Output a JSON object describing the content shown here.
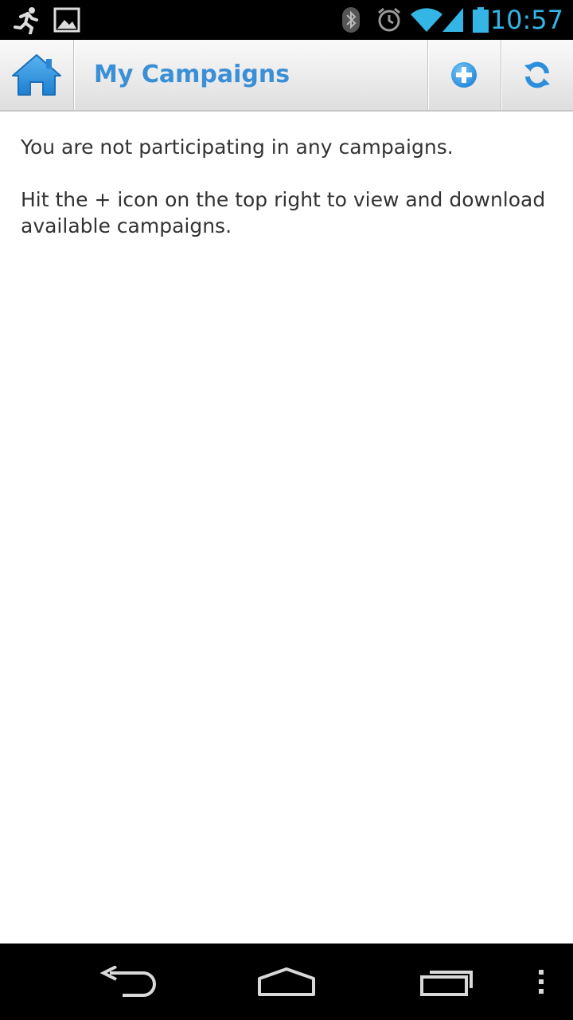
{
  "status_bar": {
    "time": "10:57",
    "icons": [
      "running-man-icon",
      "image-icon",
      "bluetooth-icon",
      "alarm-icon",
      "wifi-icon",
      "signal-icon",
      "battery-icon"
    ],
    "time_color": "#33b5e5"
  },
  "action_bar": {
    "home_icon": "home-icon",
    "title": "My Campaigns",
    "actions": [
      "add-icon",
      "refresh-icon"
    ],
    "accent_color": "#3a8fd6"
  },
  "content": {
    "message_1": "You are not participating in any campaigns.",
    "message_2": "Hit the + icon on the top right to view and download available campaigns."
  },
  "nav_bar": {
    "buttons": [
      "back-icon",
      "home-icon",
      "recent-apps-icon",
      "menu-icon"
    ]
  }
}
